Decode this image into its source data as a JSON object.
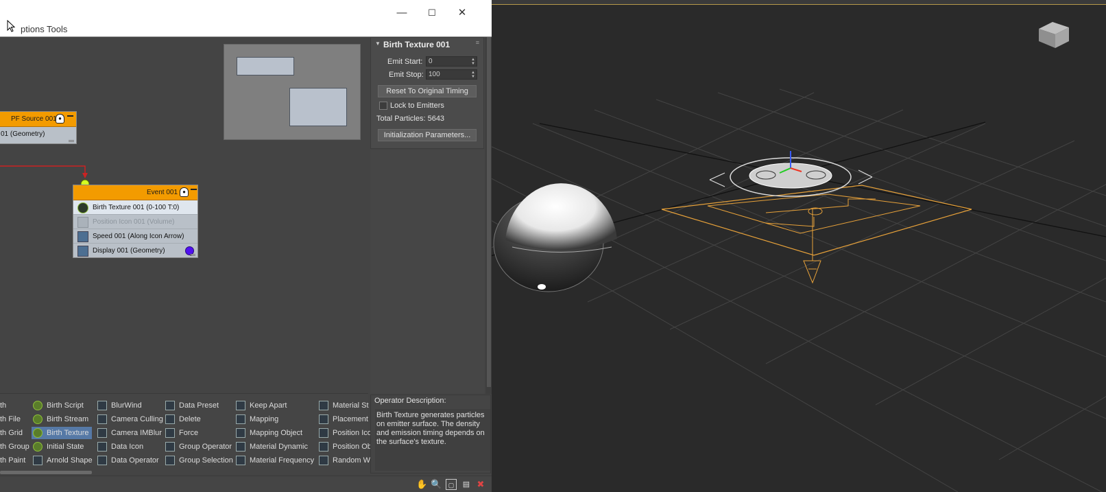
{
  "window": {
    "menu": [
      {
        "label": "Options"
      },
      {
        "label": "Tools"
      }
    ],
    "menu_visible": [
      "ptions",
      "Tools"
    ]
  },
  "graph": {
    "source_node": {
      "title": "PF Source 001",
      "row_label": "01 (Geometry)"
    },
    "event_node": {
      "title": "Event 001",
      "operators": [
        {
          "label": "Birth Texture 001 (0-100 T:0)",
          "state": "selected",
          "icon": "birth-texture-icon"
        },
        {
          "label": "Position Icon 001 (Volume)",
          "state": "disabled",
          "icon": "position-icon"
        },
        {
          "label": "Speed 001 (Along Icon Arrow)",
          "state": "normal",
          "icon": "speed-icon"
        },
        {
          "label": "Display 001 (Geometry)",
          "state": "normal",
          "icon": "display-icon",
          "color": "#5010f0"
        }
      ]
    }
  },
  "params": {
    "title": "Birth Texture 001",
    "emit_start": {
      "label": "Emit Start:",
      "value": "0"
    },
    "emit_stop": {
      "label": "Emit Stop:",
      "value": "100"
    },
    "reset_button": "Reset To Original Timing",
    "lock_label": "Lock to Emitters",
    "lock_checked": false,
    "total_particles": "Total Particles: 5643",
    "init_button": "Initialization Parameters..."
  },
  "depot": {
    "columns": [
      [
        "th",
        "th File",
        "th Grid",
        "th Group",
        "th Paint"
      ],
      [
        "Birth Script",
        "Birth Stream",
        "Birth Texture",
        "Initial State",
        "Arnold Shape"
      ],
      [
        "BlurWind",
        "Camera Culling",
        "Camera IMBlur",
        "Data Icon",
        "Data Operator"
      ],
      [
        "Data Preset",
        "Delete",
        "Force",
        "Group Operator",
        "Group Selection"
      ],
      [
        "Keep Apart",
        "Mapping",
        "Mapping Object",
        "Material Dynamic",
        "Material Frequency"
      ],
      [
        "Material St",
        "Placement",
        "Position Ico",
        "Position Ob",
        "Random W"
      ]
    ],
    "selected": "Birth Texture"
  },
  "description": {
    "title": "Operator Description:",
    "text": "Birth Texture generates particles on emitter surface. The density and emission timing depends on the surface's texture."
  },
  "colors": {
    "event_header": "#f39b00",
    "selection": "#5679a6",
    "wire": "#cc2222",
    "selection_bracket": "#e8a23a",
    "display_color": "#5010f0"
  },
  "viewport": {
    "navigation": "view-cube-icon"
  }
}
